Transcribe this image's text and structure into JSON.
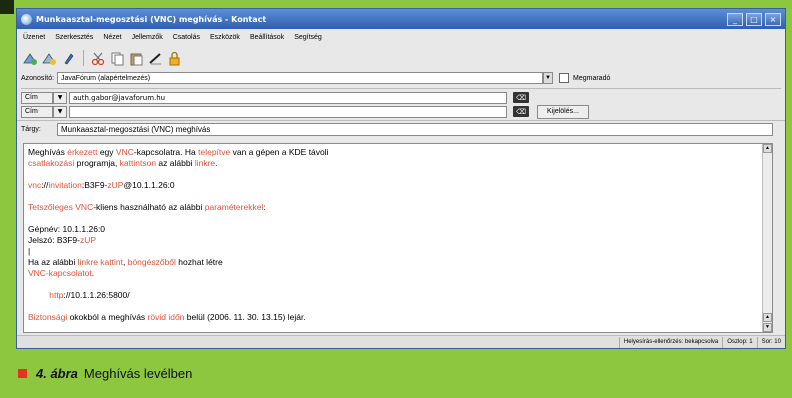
{
  "window": {
    "title": "Munkaasztal-megosztási (VNC) meghívás - Kontact",
    "buttons": [
      "_",
      "□",
      "×"
    ]
  },
  "menubar": [
    "Üzenet",
    "Szerkesztés",
    "Nézet",
    "Jellemzők",
    "Csatolás",
    "Eszközök",
    "Beállítások",
    "Segítség"
  ],
  "identity": {
    "label": "Azonosító:",
    "value": "JavaFórum (alapértelmezés)",
    "checkbox_label": "Megmaradó"
  },
  "recipients": [
    {
      "type": "Cím",
      "value": "auth.gabor@javaforum.hu"
    },
    {
      "type": "Cím",
      "value": ""
    }
  ],
  "select_button": "Kijelölés...",
  "subject": {
    "label": "Tárgy:",
    "value": "Munkaasztal-megosztási (VNC) meghívás"
  },
  "body_lines": [
    [
      [
        "Meghívás ",
        ""
      ],
      [
        "érkezett",
        "r"
      ],
      [
        " egy ",
        ""
      ],
      [
        "VNC",
        "r"
      ],
      [
        "-kapcsolatra. Ha ",
        ""
      ],
      [
        "telepítve",
        "r"
      ],
      [
        " van a gépen a KDE távoli",
        ""
      ]
    ],
    [
      [
        "csatlakozási",
        "r"
      ],
      [
        " programja, ",
        ""
      ],
      [
        "kattintson",
        "r"
      ],
      [
        " az alábbi ",
        ""
      ],
      [
        "linkre",
        "r"
      ],
      [
        ".",
        ""
      ]
    ],
    [],
    [
      [
        "vnc",
        "r"
      ],
      [
        "://",
        ""
      ],
      [
        "invitation",
        "r"
      ],
      [
        ":B3F9-",
        ""
      ],
      [
        "zUP",
        "r"
      ],
      [
        "@10.1.1.26:0",
        ""
      ]
    ],
    [],
    [
      [
        "Tetszőleges",
        "r"
      ],
      [
        " ",
        ""
      ],
      [
        "VNC",
        "r"
      ],
      [
        "-kliens használható az alábbi ",
        ""
      ],
      [
        "paraméterekkel",
        "r"
      ],
      [
        ":",
        ""
      ]
    ],
    [],
    [
      [
        "Gépnév: 10.1.1.26:0",
        ""
      ]
    ],
    [
      [
        "Jelszó: B3F9-",
        ""
      ],
      [
        "zUP",
        "r"
      ]
    ],
    [
      [
        "|",
        ""
      ]
    ],
    [
      [
        "Ha az alábbi ",
        ""
      ],
      [
        "linkre kattint",
        "r"
      ],
      [
        ", ",
        ""
      ],
      [
        "böngészőből",
        "r"
      ],
      [
        " hozhat létre",
        ""
      ]
    ],
    [
      [
        "VNC-kapcsolatot",
        "r"
      ],
      [
        ".",
        ""
      ]
    ],
    [],
    [
      [
        "         ",
        ""
      ],
      [
        "http",
        "r"
      ],
      [
        "://10.1.1.26:5800/",
        ""
      ]
    ],
    [],
    [
      [
        "Biztonsági",
        "r"
      ],
      [
        " okokból a meghívás ",
        ""
      ],
      [
        "rövid időn",
        "r"
      ],
      [
        " belül (2006. 11. 30. 13.15) lejár.",
        ""
      ]
    ]
  ],
  "statusbar": [
    "Helyesírás-ellenőrzés: bekapcsolva",
    "Oszlop: 1",
    "Sor: 10"
  ],
  "caption": {
    "number": "4. ábra",
    "text": "Meghívás levélben"
  },
  "colors": {
    "accent_red": "#e0533a",
    "background": "#8dc63f",
    "caption_square": "#e8311f"
  }
}
